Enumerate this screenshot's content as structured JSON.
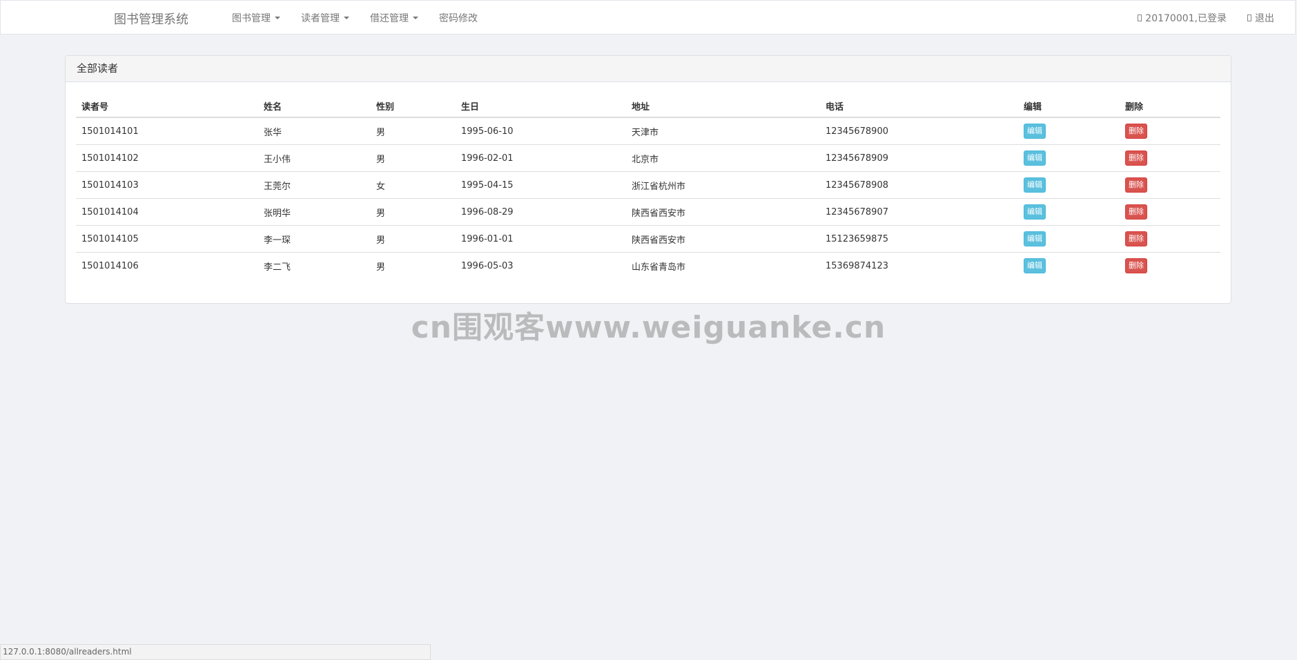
{
  "navbar": {
    "brand": "图书管理系统",
    "menu": [
      {
        "label": "图书管理",
        "dropdown": true
      },
      {
        "label": "读者管理",
        "dropdown": true
      },
      {
        "label": "借还管理",
        "dropdown": true
      },
      {
        "label": "密码修改",
        "dropdown": false
      }
    ],
    "user_status": "20170001,已登录",
    "logout": "退出"
  },
  "panel": {
    "title": "全部读者",
    "columns": [
      "读者号",
      "姓名",
      "性别",
      "生日",
      "地址",
      "电话",
      "编辑",
      "删除"
    ],
    "edit_label": "编辑",
    "delete_label": "删除",
    "rows": [
      {
        "id": "1501014101",
        "name": "张华",
        "sex": "男",
        "birthday": "1995-06-10",
        "address": "天津市",
        "phone": "12345678900"
      },
      {
        "id": "1501014102",
        "name": "王小伟",
        "sex": "男",
        "birthday": "1996-02-01",
        "address": "北京市",
        "phone": "12345678909"
      },
      {
        "id": "1501014103",
        "name": "王莞尔",
        "sex": "女",
        "birthday": "1995-04-15",
        "address": "浙江省杭州市",
        "phone": "12345678908"
      },
      {
        "id": "1501014104",
        "name": "张明华",
        "sex": "男",
        "birthday": "1996-08-29",
        "address": "陕西省西安市",
        "phone": "12345678907"
      },
      {
        "id": "1501014105",
        "name": "李一琛",
        "sex": "男",
        "birthday": "1996-01-01",
        "address": "陕西省西安市",
        "phone": "15123659875"
      },
      {
        "id": "1501014106",
        "name": "李二飞",
        "sex": "男",
        "birthday": "1996-05-03",
        "address": "山东省青岛市",
        "phone": "15369874123"
      }
    ]
  },
  "watermark": "cn围观客www.weiguanke.cn",
  "statusbar": {
    "url": "127.0.0.1:8080/allreaders.html"
  },
  "colors": {
    "background": "#f0f2f5",
    "edit_button": "#5bc0de",
    "delete_button": "#d9534f"
  }
}
